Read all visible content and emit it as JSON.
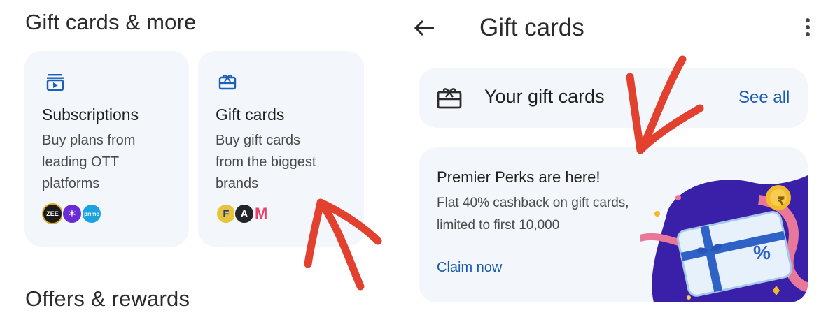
{
  "left": {
    "section_title": "Gift cards & more",
    "cards": [
      {
        "title": "Subscriptions",
        "desc_lines": [
          "Buy plans from",
          "leading OTT",
          "platforms"
        ],
        "icon": "subscriptions-icon",
        "logos": [
          {
            "name": "zee5-logo",
            "text": "ZEE",
            "color": "#1c1c1c"
          },
          {
            "name": "sonyliv-logo",
            "text": "",
            "color": "#6a2bd4"
          },
          {
            "name": "prime-logo",
            "text": "prime",
            "color": "#1aa3e0"
          }
        ]
      },
      {
        "title": "Gift cards",
        "desc_lines": [
          "Buy gift cards",
          "from the biggest",
          "brands"
        ],
        "icon": "gift-card-icon",
        "logos": [
          {
            "name": "flipkart-logo",
            "text": "F",
            "color": "#e8c43a"
          },
          {
            "name": "amazon-logo",
            "text": "A",
            "color": "#22262b"
          },
          {
            "name": "myntra-logo",
            "text": "M",
            "color": "#ffffff"
          }
        ]
      }
    ],
    "offers_title": "Offers & rewards"
  },
  "right": {
    "header_title": "Gift cards",
    "your_gift_cards": {
      "label": "Your gift cards",
      "see_all": "See all"
    },
    "promo": {
      "title": "Premier Perks are here!",
      "desc_lines": [
        "Flat 40% cashback on gift cards,",
        "limited to first 10,000"
      ],
      "cta": "Claim now",
      "badge_symbol": "%",
      "coin_symbol": "₹"
    }
  },
  "colors": {
    "card_bg": "#f3f6fa",
    "link_blue": "#1a5bb0",
    "annotation_red": "#e2412f",
    "promo_purple": "#3a1fa8"
  }
}
